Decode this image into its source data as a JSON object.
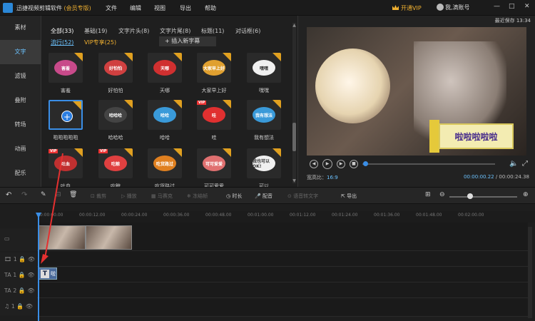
{
  "app": {
    "title": "迅捷视频剪辑软件",
    "badge": "(会员专版)",
    "autosave": "最近保存 13:34",
    "vip": "开通VIP",
    "account": "我,滴账号",
    "minimize": "—",
    "maximize": "□",
    "close": "✕"
  },
  "menu": [
    "文件",
    "编辑",
    "视图",
    "导出",
    "帮助"
  ],
  "sidebar": [
    "素材",
    "文字",
    "滤镜",
    "叠附",
    "转场",
    "动画",
    "配乐"
  ],
  "library": {
    "tabs": [
      "全部(33)",
      "基础(19)",
      "文字片头(8)",
      "文字片尾(8)",
      "标题(11)",
      "对话框(6)"
    ],
    "subtabs": [
      "流行(52)",
      "VIP专享(25)"
    ],
    "add_button": "插入新字幕",
    "tiles": [
      {
        "label": "害羞",
        "sticker": "害羞",
        "color": "#c84a8a",
        "vip": false
      },
      {
        "label": "好怕怕",
        "sticker": "好怕怕",
        "color": "#d04040",
        "vip": false
      },
      {
        "label": "天哪",
        "sticker": "天哪",
        "color": "#d03030",
        "vip": false
      },
      {
        "label": "大家早上好",
        "sticker": "大家早上好",
        "color": "#e0a030",
        "vip": false
      },
      {
        "label": "嘿嘿",
        "sticker": "嘿嘿",
        "color": "#f0f0f0",
        "vip": false
      },
      {
        "label": "啦啦啦啦啦",
        "sticker": "",
        "color": "#2a7de1",
        "vip": false
      },
      {
        "label": "哈哈哈",
        "sticker": "哈哈哈",
        "color": "#444",
        "vip": false
      },
      {
        "label": "哈哈",
        "sticker": "哈哈",
        "color": "#3a9ad9",
        "vip": false
      },
      {
        "label": "哇",
        "sticker": "哇",
        "color": "#e03030",
        "vip": true
      },
      {
        "label": "我有想法",
        "sticker": "我有想法",
        "color": "#3a9ad9",
        "vip": false
      },
      {
        "label": "吐血",
        "sticker": "吐血",
        "color": "#c03030",
        "vip": true
      },
      {
        "label": "吃鲸",
        "sticker": "吃鲸",
        "color": "#e04040",
        "vip": true
      },
      {
        "label": "吃货路过",
        "sticker": "吃货路过",
        "color": "#e08020",
        "vip": false
      },
      {
        "label": "可可爱爱",
        "sticker": "可可爱爱",
        "color": "#e07070",
        "vip": false
      },
      {
        "label": "可以",
        "sticker": "我也可以OK!",
        "color": "#f0f0f0",
        "vip": false
      }
    ]
  },
  "preview": {
    "caption": "啦啦啦啦啦",
    "ratio_label": "宽高比：",
    "ratio_value": "16:9",
    "time_current": "00:00:00.22",
    "time_total": "00:00:24.38",
    "progress": 0.02
  },
  "toolbar": [
    "撤销",
    "重做",
    "删除",
    "裁剪",
    "播放",
    "马赛克",
    "冻结帧",
    "时长",
    "配音",
    "语音转文字",
    "导出"
  ],
  "ruler": [
    "00:00:00.00",
    "00:00:12.00",
    "00:00:24.00",
    "00:00:36.00",
    "00:00:48.00",
    "00:01:00.00",
    "00:01:12.00",
    "00:01:24.00",
    "00:01:36.00",
    "00:01:48.00",
    "00:02:00.00"
  ],
  "timeline": {
    "text_clip_label": "啦"
  }
}
